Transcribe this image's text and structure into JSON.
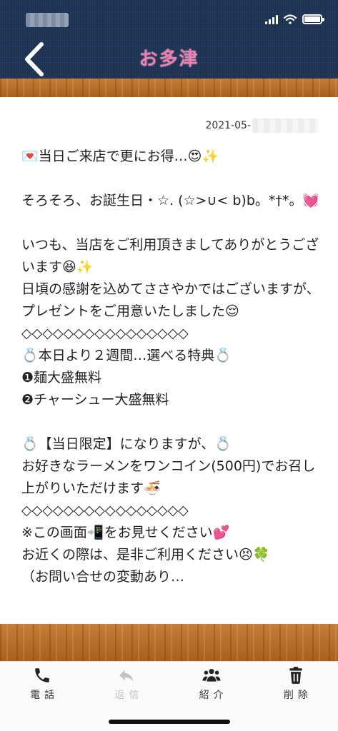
{
  "header": {
    "title": "お多津",
    "back_icon": "chevron-left-icon",
    "background_color": "#1f3557",
    "title_color": "#f27fb4"
  },
  "status_bar": {
    "icons": [
      "signal-icon",
      "wifi-icon",
      "battery-icon"
    ]
  },
  "message": {
    "date_prefix": "2021-05-",
    "body": "💌当日ご来店で更にお得…😍✨\n\nそろそろ、お誕生日・☆. (☆>∪< b)b。*†*。💓\n\nいつも、当店をご利用頂きましてありがとうございます😆✨\n日頃の感謝を込めてささやかではございますが、プレゼントをご用意いたしました😌\n◇◇◇◇◇◇◇◇◇◇◇◇◇◇◇◇\n💍本日より２週間…選べる特典💍\n❶麺大盛無料\n❷チャーシュー大盛無料\n\n💍【当日限定】になりますが、💍\nお好きなラーメンをワンコイン(500円)でお召し上がりいただけます🍜\n◇◇◇◇◇◇◇◇◇◇◇◇◇◇◇◇\n※この画面📲をお見せください💕\nお近くの際は、是非ご利用ください😣🍀\n（お問い合せの変動あり…"
  },
  "tabbar": {
    "tabs": [
      {
        "label": "電話",
        "icon": "phone-icon",
        "enabled": true
      },
      {
        "label": "返信",
        "icon": "reply-icon",
        "enabled": false
      },
      {
        "label": "紹介",
        "icon": "users-icon",
        "enabled": true
      },
      {
        "label": "削除",
        "icon": "trash-icon",
        "enabled": true
      }
    ]
  }
}
